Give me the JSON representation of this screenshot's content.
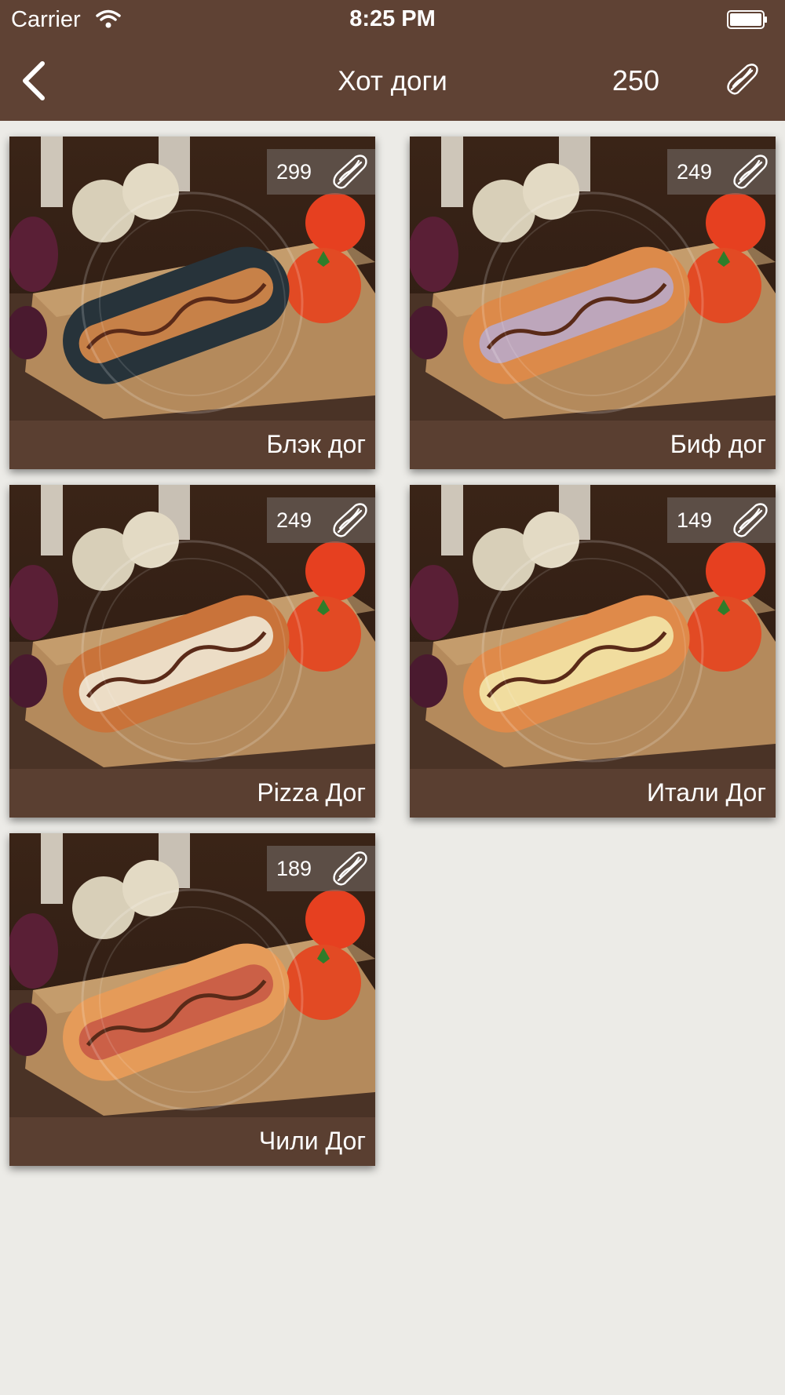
{
  "status_bar": {
    "carrier": "Carrier",
    "time": "8:25 PM"
  },
  "nav": {
    "title": "Хот доги",
    "balance": "250"
  },
  "products": [
    {
      "name": "Блэк дог",
      "price": "299",
      "bun": "#27333a",
      "topping": "#d98a4a"
    },
    {
      "name": "Биф дог",
      "price": "249",
      "bun": "#dc8a4a",
      "topping": "#b9a8c8"
    },
    {
      "name": "Pizza Дог",
      "price": "249",
      "bun": "#c9733a",
      "topping": "#efe9d6"
    },
    {
      "name": "Итали Дог",
      "price": "149",
      "bun": "#df8a4a",
      "topping": "#f3e6a8"
    },
    {
      "name": "Чили Дог",
      "price": "189",
      "bun": "#e59b59",
      "topping": "#c85a45"
    }
  ],
  "colors": {
    "header": "#5f4234",
    "background": "#ecebe7",
    "name_bar": "#5e4234"
  },
  "icons": {
    "back": "chevron-left-icon",
    "hotdog": "hotdog-icon",
    "wifi": "wifi-icon",
    "battery": "battery-icon"
  }
}
